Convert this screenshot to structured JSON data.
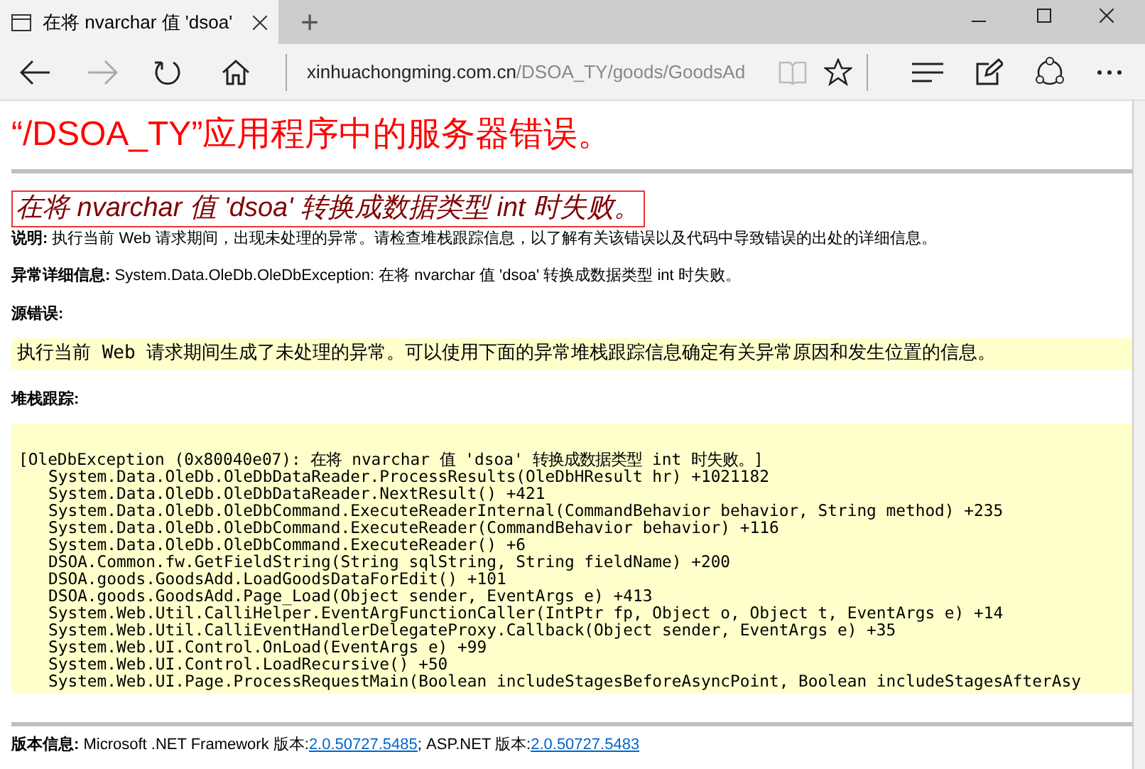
{
  "browser": {
    "tab": {
      "title": "在将 nvarchar 值 'dsoa'",
      "selected": true
    },
    "new_tab": "+",
    "address": {
      "domain": "xinhuachongming.com.cn",
      "path": "/DSOA_TY/goods/GoodsAd"
    }
  },
  "page": {
    "title": "“/DSOA_TY”应用程序中的服务器错误。",
    "subtitle": "在将 nvarchar 值 'dsoa' 转换成数据类型 int 时失败。",
    "description": "**说明:** 执行当前 Web 请求期间，出现未处理的异常。请检查堆栈跟踪信息，以了解有关该错误以及代码中导致错误的出处的详细信息。",
    "exception_details": "**异常详细信息:** System.Data.OleDb.OleDbException: 在将 nvarchar 值 'dsoa' 转换成数据类型 int 时失败。",
    "source_error_label": "源错误:",
    "source_error": "执行当前 Web 请求期间生成了未处理的异常。可以使用下面的异常堆栈跟踪信息确定有关异常原因和发生位置的信息。",
    "stack_trace_label": "堆栈跟踪:",
    "stack_trace": {
      "heading": "[OleDbException (0x80040e07): 在将 nvarchar 值 'dsoa' 转换成数据类型 int 时失败。]",
      "children": [
        "System.Data.OleDb.OleDbDataReader.ProcessResults(OleDbHResult hr) +1021182",
        "System.Data.OleDb.OleDbDataReader.NextResult() +421",
        "System.Data.OleDb.OleDbCommand.ExecuteReaderInternal(CommandBehavior behavior, String method) +235",
        "System.Data.OleDb.OleDbCommand.ExecuteReader(CommandBehavior behavior) +116",
        "System.Data.OleDb.OleDbCommand.ExecuteReader() +6",
        "DSOA.Common.fw.GetFieldString(String sqlString, String fieldName) +200",
        "DSOA.goods.GoodsAdd.LoadGoodsDataForEdit() +101",
        "DSOA.goods.GoodsAdd.Page_Load(Object sender, EventArgs e) +413",
        "System.Web.Util.CalliHelper.EventArgFunctionCaller(IntPtr fp, Object o, Object t, EventArgs e) +14",
        "System.Web.Util.CalliEventHandlerDelegateProxy.Callback(Object sender, EventArgs e) +35",
        "System.Web.UI.Control.OnLoad(EventArgs e) +99",
        "System.Web.UI.Control.LoadRecursive() +50",
        "System.Web.UI.Page.ProcessRequestMain(Boolean includeStagesBeforeAsyncPoint, Boolean includeStagesAfterAsy"
      ]
    },
    "version": {
      "label": "版本信息:",
      "text_1": " Microsoft .NET Framework 版本:",
      "link_1": "2.0.50727.5485",
      "text_2": "; ASP.NET 版本:",
      "link_2": "2.0.50727.5483"
    }
  }
}
